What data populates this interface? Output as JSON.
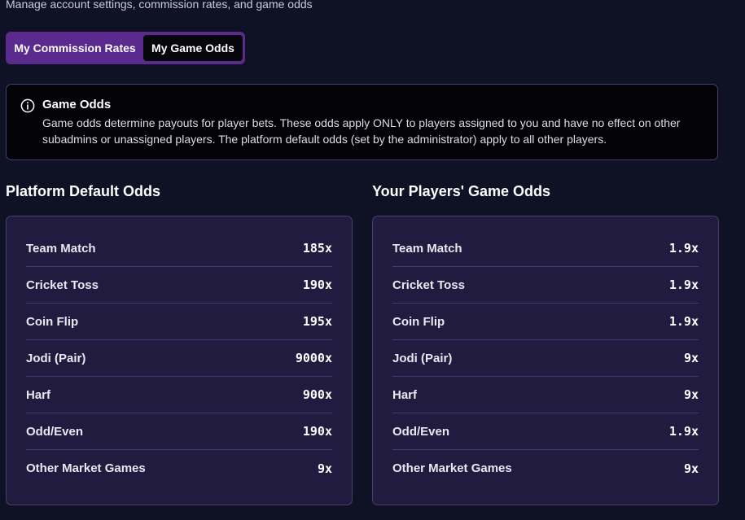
{
  "header": {
    "subtitle": "Manage account settings, commission rates, and game odds"
  },
  "tabs": [
    {
      "label": "My Commission Rates",
      "active": false
    },
    {
      "label": "My Game Odds",
      "active": true
    }
  ],
  "info": {
    "icon": "info-icon",
    "title": "Game Odds",
    "text": "Game odds determine payouts for player bets. These odds apply ONLY to players assigned to you and have no effect on other subadmins or unassigned players. The platform default odds (set by the administrator) apply to all other players."
  },
  "platform_odds": {
    "title": "Platform Default Odds",
    "rows": [
      {
        "name": "Team Match",
        "value": "185x"
      },
      {
        "name": "Cricket Toss",
        "value": "190x"
      },
      {
        "name": "Coin Flip",
        "value": "195x"
      },
      {
        "name": "Jodi (Pair)",
        "value": "9000x"
      },
      {
        "name": "Harf",
        "value": "900x"
      },
      {
        "name": "Odd/Even",
        "value": "190x"
      },
      {
        "name": "Other Market Games",
        "value": "9x"
      }
    ]
  },
  "player_odds": {
    "title": "Your Players' Game Odds",
    "rows": [
      {
        "name": "Team Match",
        "value": "1.9x"
      },
      {
        "name": "Cricket Toss",
        "value": "1.9x"
      },
      {
        "name": "Coin Flip",
        "value": "1.9x"
      },
      {
        "name": "Jodi (Pair)",
        "value": "9x"
      },
      {
        "name": "Harf",
        "value": "9x"
      },
      {
        "name": "Odd/Even",
        "value": "1.9x"
      },
      {
        "name": "Other Market Games",
        "value": "9x"
      }
    ]
  },
  "colors": {
    "background": "#0e1224",
    "tab_group": "#5b2a8f",
    "active_tab": "#06060b",
    "card": "#211b40",
    "divider": "#4b3478"
  }
}
